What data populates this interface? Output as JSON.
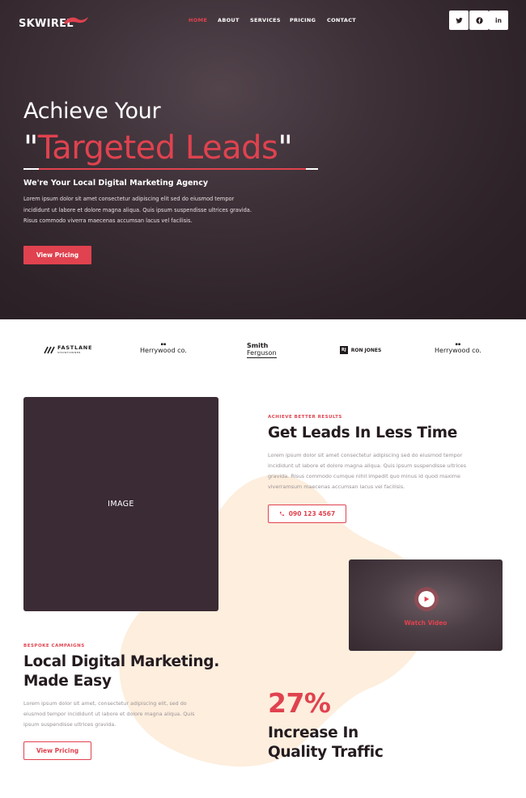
{
  "header": {
    "logo_text": "SKWIREL",
    "nav": [
      "HOME",
      "ABOUT",
      "SERVICES",
      "PRICING",
      "CONTACT"
    ],
    "social_icons": [
      "twitter-icon",
      "facebook-icon",
      "linkedin-icon"
    ]
  },
  "hero": {
    "title_line1": "Achieve Your",
    "title_quote_open": "\"",
    "title_accent": "Targeted Leads",
    "title_quote_close": "\"",
    "subtitle": "We're Your Local Digital Marketing Agency",
    "body_line1": "Lorem ipsum dolor sit amet consectetur adipiscing elit sed do eiusmod tempor",
    "body_line2": "incididunt ut labore et dolore magna aliqua. Quis ipsum suspendisse ultrices gravida.",
    "body_line3": "Risus commodo viverra maecenas accumsan lacus vel facilisis.",
    "cta": "View Pricing"
  },
  "brands": {
    "b1_main": "FASTLANE",
    "b1_sub": "SHOWTOWNER",
    "b2": "Herrywood co.",
    "b3_line1": "Smith",
    "b3_line2": "Ferguson",
    "b4_mark": "RJ",
    "b4": "RON JONES",
    "b5": "Herrywood co."
  },
  "leads": {
    "image_label": "IMAGE",
    "kicker": "ACHIEVE BETTER RESULTS",
    "heading": "Get Leads In Less Time",
    "body_line1": "Lorem ipsum dolor sit amet consectetur adipiscing sed do eiusmod tempor",
    "body_line2": "incididunt ut labore et dolore magna aliqua. Quis ipsum suspendisse ultrices",
    "body_line3": "gravida. Risus commodo cumque nihil impedit quo minus id quod maxime",
    "body_line4": "viverramsum maecenas accumsan lacus vel facilisis.",
    "phone": "090 123 4567"
  },
  "video": {
    "label": "Watch Video"
  },
  "bespoke": {
    "kicker": "BESPOKE CAMPAIGNS",
    "heading_line1": "Local Digital Marketing.",
    "heading_line2": "Made Easy",
    "body_line1": "Lorem ipsum dolor sit amet, consectetur adipiscing elit, sed do",
    "body_line2": "eiusmod tempor incididunt ut labore et dolore magna aliqua. Quis",
    "body_line3": "ipsum suspendisse ultrices gravida.",
    "cta": "View Pricing"
  },
  "stat": {
    "number": "27%",
    "label_line1": "Increase In",
    "label_line2": "Quality Traffic"
  },
  "colors": {
    "accent": "#e0424f",
    "hero_bg": "#3a2d34",
    "image_bg": "#3b2b35",
    "blob": "#fdeedd"
  }
}
